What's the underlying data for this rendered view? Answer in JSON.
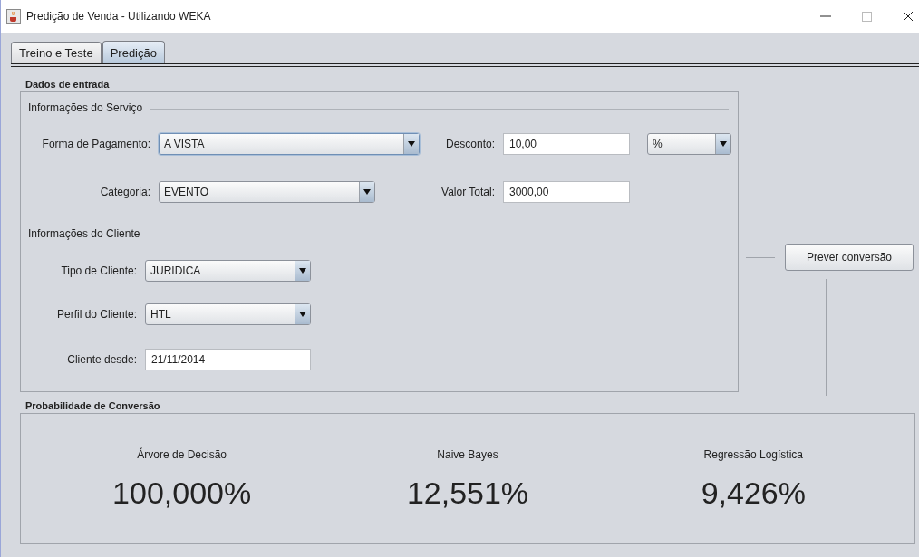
{
  "window": {
    "title": "Predição de Venda - Utilizando WEKA"
  },
  "tabs": [
    {
      "label": "Treino e Teste",
      "selected": false
    },
    {
      "label": "Predição",
      "selected": true
    }
  ],
  "input_section": {
    "title": "Dados de entrada",
    "service": {
      "title": "Informações do Serviço",
      "payment": {
        "label": "Forma de Pagamento:",
        "value": "A VISTA"
      },
      "discount": {
        "label": "Desconto:",
        "value": "10,00",
        "unit": "%"
      },
      "category": {
        "label": "Categoria:",
        "value": "EVENTO"
      },
      "total": {
        "label": "Valor Total:",
        "value": "3000,00"
      }
    },
    "client": {
      "title": "Informações do Cliente",
      "type": {
        "label": "Tipo de Cliente:",
        "value": "JURIDICA"
      },
      "profile": {
        "label": "Perfil do Cliente:",
        "value": "HTL"
      },
      "since": {
        "label": "Cliente desde:",
        "value": "21/11/2014"
      }
    }
  },
  "predict_button": "Prever conversão",
  "results": {
    "title": "Probabilidade de Conversão",
    "models": [
      {
        "name": "Árvore de Decisão",
        "value": "100,000%"
      },
      {
        "name": "Naive Bayes",
        "value": "12,551%"
      },
      {
        "name": "Regressão Logística",
        "value": "9,426%"
      }
    ]
  }
}
